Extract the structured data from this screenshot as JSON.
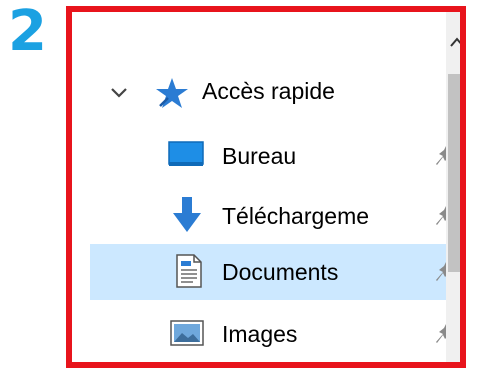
{
  "annotation": {
    "step": "2"
  },
  "nav": {
    "quick_access": {
      "label": "Accès rapide",
      "expanded": true
    },
    "items": [
      {
        "label": "Bureau",
        "icon": "desktop-icon",
        "pinned": true,
        "selected": false
      },
      {
        "label": "Téléchargeme",
        "icon": "download-arrow-icon",
        "pinned": true,
        "selected": false
      },
      {
        "label": "Documents",
        "icon": "document-icon",
        "pinned": true,
        "selected": true
      },
      {
        "label": "Images",
        "icon": "image-icon",
        "pinned": true,
        "selected": false
      }
    ]
  },
  "colors": {
    "highlight": "#e8141c",
    "step": "#1ba1e2",
    "selected_bg": "#cce8ff",
    "accent": "#2b7cd3"
  }
}
